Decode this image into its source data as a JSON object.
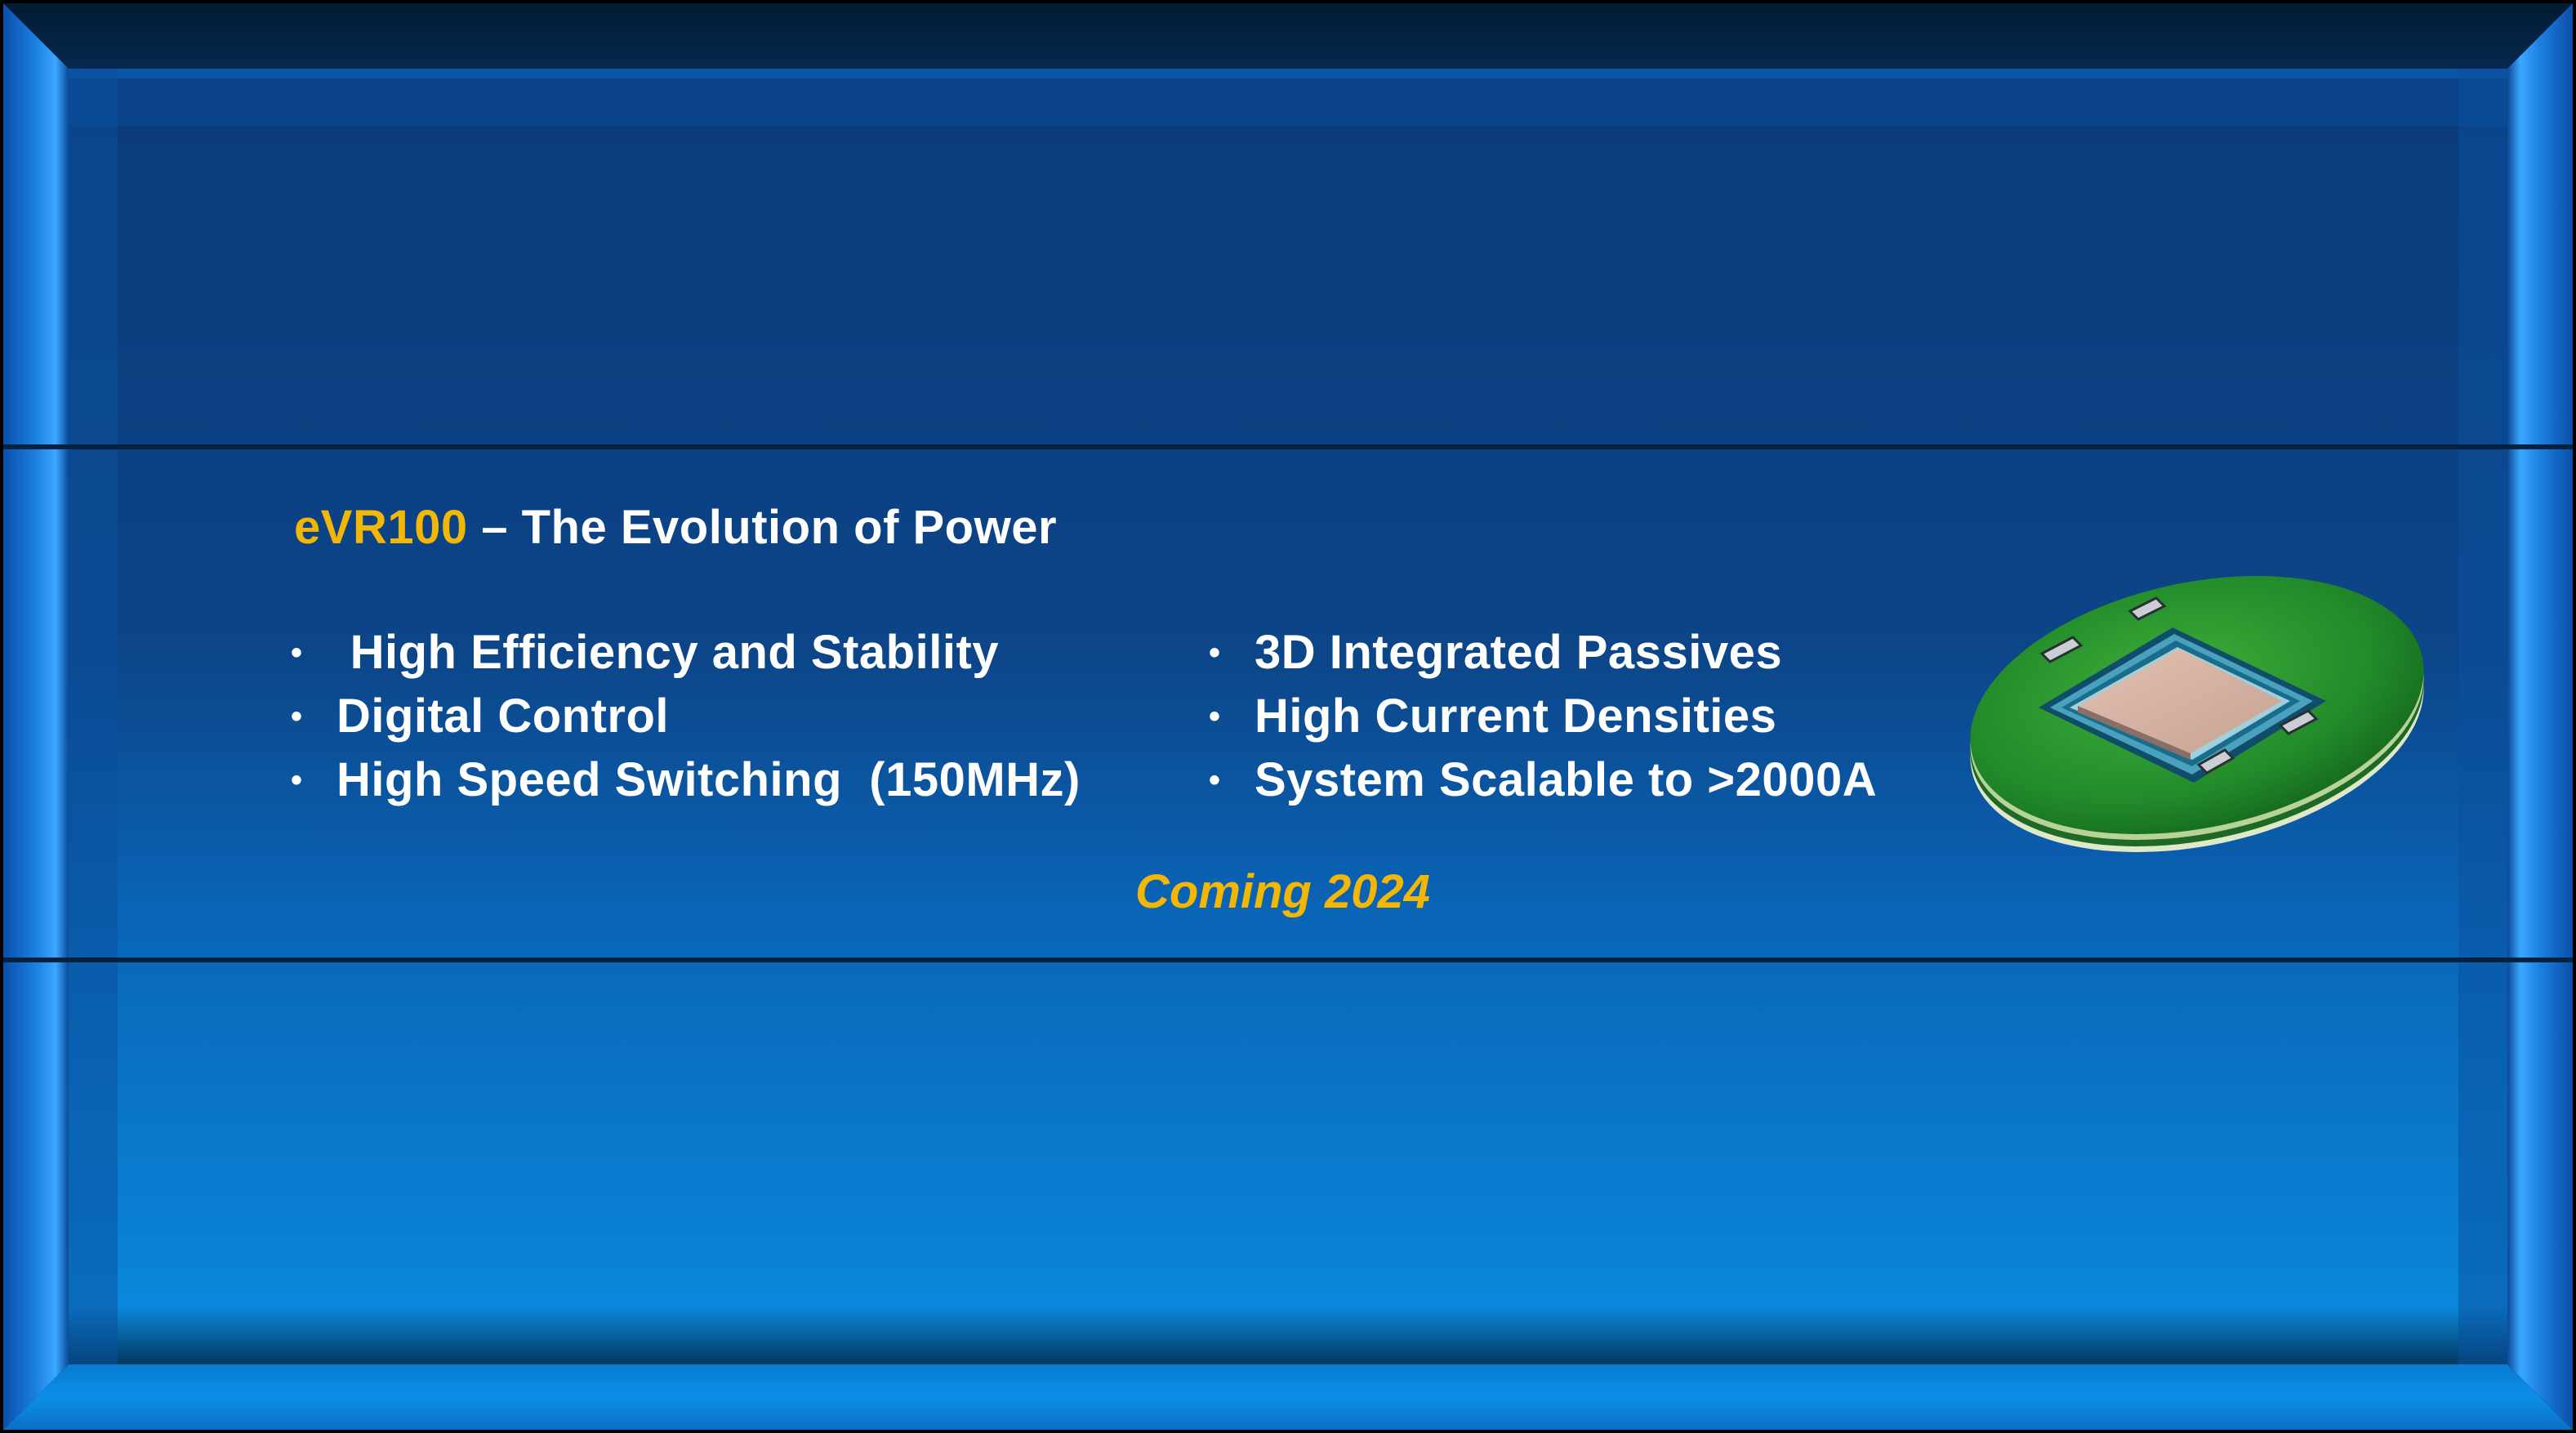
{
  "title": {
    "accent": "eVR100",
    "rest": " – The Evolution of Power"
  },
  "features_left": [
    " High Efficiency and Stability",
    "Digital Control",
    "High Speed Switching  (150MHz)"
  ],
  "features_right": [
    "3D Integrated Passives",
    "High Current Densities",
    "System Scalable to >2000A"
  ],
  "bullet_glyph": "•",
  "tagline": "Coming 2024",
  "icons": {
    "chip": "chip-module-icon"
  },
  "colors": {
    "accent": "#f2b705",
    "text": "#ffffff",
    "panel_top": "#0b3a78",
    "panel_bottom": "#0a88d8",
    "board_green": "#2e9a32"
  }
}
